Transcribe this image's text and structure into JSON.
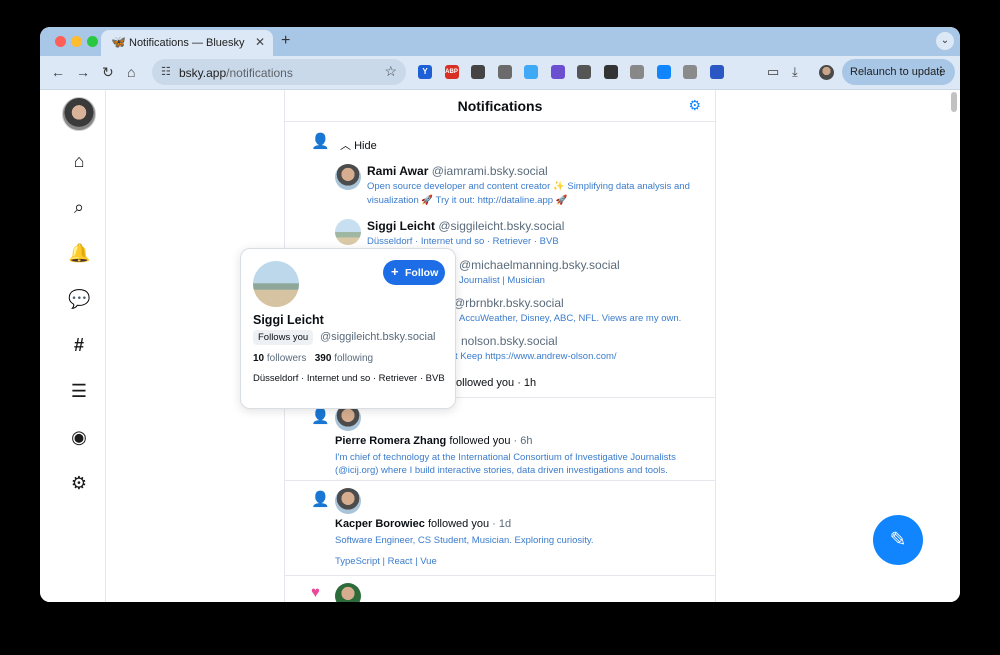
{
  "browser": {
    "tab_title": "Notifications — Bluesky",
    "tab_favicon": "butterfly-icon",
    "url_host": "bsky.app",
    "url_path": "/notifications",
    "relaunch_label": "Relaunch to update",
    "extensions": [
      {
        "icon": "extension-y-icon",
        "color": "#1d5fd6",
        "text": "Y"
      },
      {
        "icon": "adblock-icon",
        "color": "#d93025",
        "text": "ABP"
      },
      {
        "icon": "screenshot-icon",
        "color": "#444444",
        "text": ""
      },
      {
        "icon": "extension-grey-icon",
        "color": "#6b6b6b",
        "text": ""
      },
      {
        "icon": "pause-icon",
        "color": "#3fa9f5",
        "text": ""
      },
      {
        "icon": "extension-purple-icon",
        "color": "#6a4fd0",
        "text": ""
      },
      {
        "icon": "extension-pin-icon",
        "color": "#555555",
        "text": ""
      },
      {
        "icon": "focus-icon",
        "color": "#333333",
        "text": ""
      },
      {
        "icon": "code-icon",
        "color": "#888888",
        "text": ""
      },
      {
        "icon": "extension-blue-icon",
        "color": "#1185fe",
        "text": ""
      },
      {
        "icon": "vue-icon",
        "color": "#8a8a8a",
        "text": ""
      },
      {
        "icon": "sidebar-icon",
        "color": "#2b57c4",
        "text": ""
      }
    ]
  },
  "app": {
    "title": "Notifications",
    "hide_label": "Hide",
    "nav_icons": [
      "home-icon",
      "search-icon",
      "notifications-bell-icon",
      "chat-icon",
      "feeds-hash-icon",
      "lists-icon",
      "profile-icon",
      "settings-icon"
    ],
    "expanded_followers": [
      {
        "name": "Rami Awar",
        "handle": "@iamrami.bsky.social",
        "bio": "Open source developer and content creator ✨ Simplifying data analysis and visualization 🚀 Try it out: http://dataline.app 🚀"
      },
      {
        "name": "Siggi Leicht",
        "handle": "@siggileicht.bsky.social",
        "bio": "Düsseldorf · Internet und so · Retriever · BVB"
      },
      {
        "name": "",
        "handle": "@michaelmanning.bsky.social",
        "bio": "Journalist | Musician"
      },
      {
        "name": "",
        "handle": "@rbrnbkr.bsky.social",
        "bio": "AccuWeather, Disney, ABC, NFL. Views are my own."
      },
      {
        "name": "",
        "handle": "nolson.bsky.social",
        "bio": "t Keep https://www.andrew-olson.com/"
      }
    ],
    "group_summary": "followed you · 1h",
    "notifications": [
      {
        "name": "Pierre Romera Zhang",
        "action": "followed you",
        "time": "· 6h",
        "bio": "I'm chief of technology at the International Consortium of Investigative Journalists (@icij.org) where I build interactive stories, data driven investigations and tools."
      },
      {
        "name": "Kacper Borowiec",
        "action": "followed you",
        "time": "· 1d",
        "bio": "Software Engineer, CS Student, Musician. Exploring curiosity.",
        "tags": "TypeScript | React | Vue"
      }
    ]
  },
  "hovercard": {
    "name": "Siggi Leicht",
    "follows_you": "Follows you",
    "handle": "@siggileicht.bsky.social",
    "follow_label": "Follow",
    "followers_count": "10",
    "followers_label": "followers",
    "following_count": "390",
    "following_label": "following",
    "bio": "Düsseldorf · Internet und so · Retriever · BVB"
  },
  "colors": {
    "accent": "#1185fe",
    "follow_button": "#1d6ee6",
    "heart": "#ec4899"
  }
}
